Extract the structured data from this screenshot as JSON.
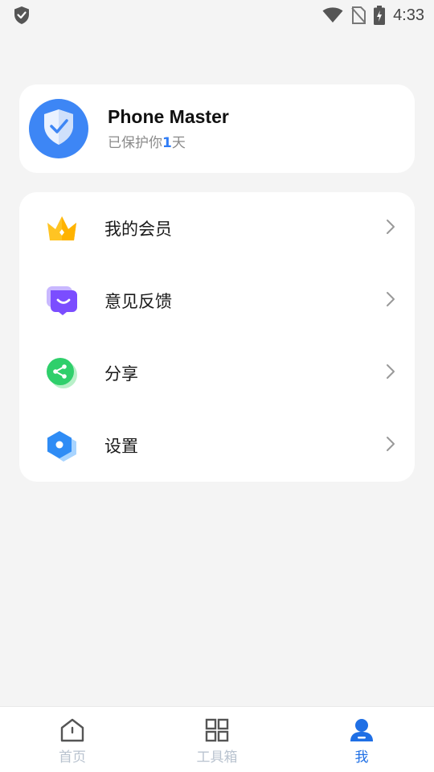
{
  "status_bar": {
    "time": "4:33",
    "left_icon": "shield-check-icon",
    "icons": [
      "wifi-icon",
      "no-sim-icon",
      "battery-charging-icon"
    ]
  },
  "profile": {
    "app_name": "Phone Master",
    "subtitle_prefix": "已保护你",
    "days": "1",
    "subtitle_suffix": "天",
    "avatar_icon": "shield-check-icon",
    "accent": "#3d86f5"
  },
  "menu": {
    "items": [
      {
        "label": "我的会员",
        "icon": "crown-icon"
      },
      {
        "label": "意见反馈",
        "icon": "feedback-icon"
      },
      {
        "label": "分享",
        "icon": "share-icon"
      },
      {
        "label": "设置",
        "icon": "settings-icon"
      }
    ]
  },
  "bottom_nav": {
    "tabs": [
      {
        "label": "首页",
        "icon": "home-icon",
        "active": false
      },
      {
        "label": "工具箱",
        "icon": "grid-icon",
        "active": false
      },
      {
        "label": "我",
        "icon": "person-icon",
        "active": true
      }
    ],
    "active_color": "#1f6fe5",
    "inactive_color": "#b9c3cf"
  }
}
